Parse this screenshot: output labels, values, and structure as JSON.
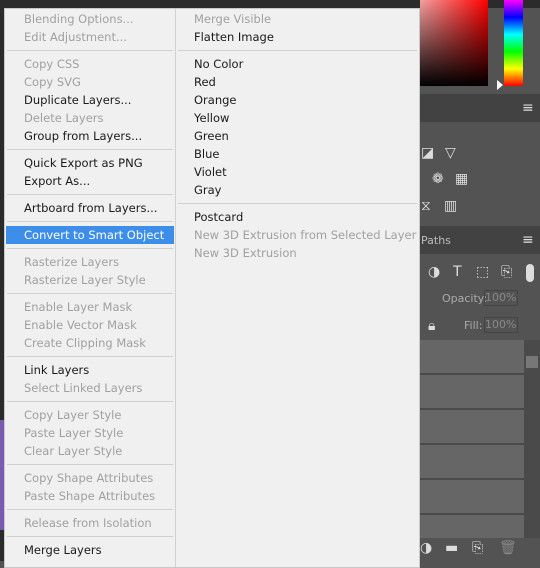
{
  "menu": {
    "left": [
      {
        "label": "Blending Options...",
        "enabled": false
      },
      {
        "label": "Edit Adjustment...",
        "enabled": false
      },
      {
        "sep": true
      },
      {
        "label": "Copy CSS",
        "enabled": false
      },
      {
        "label": "Copy SVG",
        "enabled": false
      },
      {
        "label": "Duplicate Layers...",
        "enabled": true
      },
      {
        "label": "Delete Layers",
        "enabled": false
      },
      {
        "label": "Group from Layers...",
        "enabled": true
      },
      {
        "sep": true
      },
      {
        "label": "Quick Export as PNG",
        "enabled": true
      },
      {
        "label": "Export As...",
        "enabled": true
      },
      {
        "sep": true
      },
      {
        "label": "Artboard from Layers...",
        "enabled": true
      },
      {
        "sep": true
      },
      {
        "label": "Convert to Smart Object",
        "enabled": true,
        "highlighted": true
      },
      {
        "sep": true
      },
      {
        "label": "Rasterize Layers",
        "enabled": false
      },
      {
        "label": "Rasterize Layer Style",
        "enabled": false
      },
      {
        "sep": true
      },
      {
        "label": "Enable Layer Mask",
        "enabled": false
      },
      {
        "label": "Enable Vector Mask",
        "enabled": false
      },
      {
        "label": "Create Clipping Mask",
        "enabled": false
      },
      {
        "sep": true
      },
      {
        "label": "Link Layers",
        "enabled": true
      },
      {
        "label": "Select Linked Layers",
        "enabled": false
      },
      {
        "sep": true
      },
      {
        "label": "Copy Layer Style",
        "enabled": false
      },
      {
        "label": "Paste Layer Style",
        "enabled": false
      },
      {
        "label": "Clear Layer Style",
        "enabled": false
      },
      {
        "sep": true
      },
      {
        "label": "Copy Shape Attributes",
        "enabled": false
      },
      {
        "label": "Paste Shape Attributes",
        "enabled": false
      },
      {
        "sep": true
      },
      {
        "label": "Release from Isolation",
        "enabled": false
      },
      {
        "sep": true
      },
      {
        "label": "Merge Layers",
        "enabled": true
      }
    ],
    "right": [
      {
        "label": "Merge Visible",
        "enabled": false
      },
      {
        "label": "Flatten Image",
        "enabled": true
      },
      {
        "sep": true
      },
      {
        "label": "No Color",
        "enabled": true
      },
      {
        "label": "Red",
        "enabled": true
      },
      {
        "label": "Orange",
        "enabled": true
      },
      {
        "label": "Yellow",
        "enabled": true
      },
      {
        "label": "Green",
        "enabled": true
      },
      {
        "label": "Blue",
        "enabled": true
      },
      {
        "label": "Violet",
        "enabled": true
      },
      {
        "label": "Gray",
        "enabled": true
      },
      {
        "sep": true
      },
      {
        "label": "Postcard",
        "enabled": true
      },
      {
        "label": "New 3D Extrusion from Selected Layer",
        "enabled": false
      },
      {
        "label": "New 3D Extrusion",
        "enabled": false
      }
    ]
  },
  "panels": {
    "paths_tab": "Paths",
    "opacity_label": "Opacity:",
    "opacity_value": "100%",
    "fill_label": "Fill:",
    "fill_value": "100%"
  },
  "colors": {
    "highlight": "#3d8ee8",
    "menu_bg": "#f0f0f0",
    "panel_bg": "#535353"
  }
}
